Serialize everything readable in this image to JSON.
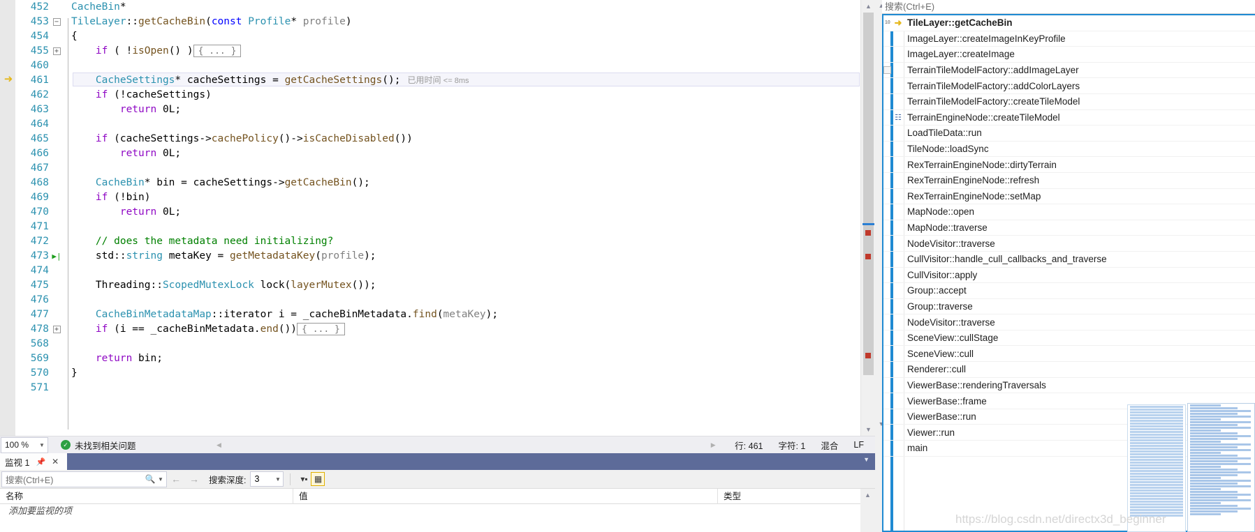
{
  "editor": {
    "current_line_arrow_icon": "execution-arrow",
    "lines": [
      {
        "num": "452",
        "glyph": "",
        "indent": 0,
        "tokens": [
          {
            "t": "CacheBin",
            "c": "t-type"
          },
          {
            "t": "*",
            "c": "t-plain"
          }
        ]
      },
      {
        "num": "453",
        "glyph": "minus",
        "indent": 0,
        "tokens": [
          {
            "t": "TileLayer",
            "c": "t-type"
          },
          {
            "t": "::",
            "c": "t-plain"
          },
          {
            "t": "getCacheBin",
            "c": "t-fn"
          },
          {
            "t": "(",
            "c": "t-plain"
          },
          {
            "t": "const",
            "c": "t-kw"
          },
          {
            "t": " ",
            "c": "t-plain"
          },
          {
            "t": "Profile",
            "c": "t-type"
          },
          {
            "t": "* ",
            "c": "t-plain"
          },
          {
            "t": "profile",
            "c": "t-param"
          },
          {
            "t": ")",
            "c": "t-plain"
          }
        ]
      },
      {
        "num": "454",
        "glyph": "",
        "indent": 0,
        "tokens": [
          {
            "t": "{",
            "c": "t-plain"
          }
        ]
      },
      {
        "num": "455",
        "glyph": "plus",
        "indent": 1,
        "tokens": [
          {
            "t": "if",
            "c": "t-ctrl"
          },
          {
            "t": " ( !",
            "c": "t-plain"
          },
          {
            "t": "isOpen",
            "c": "t-fn"
          },
          {
            "t": "() )",
            "c": "t-plain"
          }
        ],
        "collapsed": "{ ... }"
      },
      {
        "num": "460",
        "glyph": "",
        "indent": 0,
        "tokens": []
      },
      {
        "num": "461",
        "glyph": "",
        "indent": 1,
        "current": true,
        "tokens": [
          {
            "t": "CacheSettings",
            "c": "t-type"
          },
          {
            "t": "* cacheSettings = ",
            "c": "t-plain"
          },
          {
            "t": "getCacheSettings",
            "c": "t-fn"
          },
          {
            "t": "();",
            "c": "t-plain"
          }
        ],
        "exec_time": "已用时间",
        "exec_time_ms": "<= 8ms"
      },
      {
        "num": "462",
        "glyph": "",
        "indent": 1,
        "tokens": [
          {
            "t": "if",
            "c": "t-ctrl"
          },
          {
            "t": " (!cacheSettings)",
            "c": "t-plain"
          }
        ]
      },
      {
        "num": "463",
        "glyph": "",
        "indent": 2,
        "tokens": [
          {
            "t": "return",
            "c": "t-ctrl"
          },
          {
            "t": " 0L;",
            "c": "t-plain"
          }
        ]
      },
      {
        "num": "464",
        "glyph": "",
        "indent": 0,
        "tokens": []
      },
      {
        "num": "465",
        "glyph": "",
        "indent": 1,
        "tokens": [
          {
            "t": "if",
            "c": "t-ctrl"
          },
          {
            "t": " (cacheSettings->",
            "c": "t-plain"
          },
          {
            "t": "cachePolicy",
            "c": "t-fn"
          },
          {
            "t": "()->",
            "c": "t-plain"
          },
          {
            "t": "isCacheDisabled",
            "c": "t-fn"
          },
          {
            "t": "())",
            "c": "t-plain"
          }
        ]
      },
      {
        "num": "466",
        "glyph": "",
        "indent": 2,
        "tokens": [
          {
            "t": "return",
            "c": "t-ctrl"
          },
          {
            "t": " 0L;",
            "c": "t-plain"
          }
        ]
      },
      {
        "num": "467",
        "glyph": "",
        "indent": 0,
        "tokens": []
      },
      {
        "num": "468",
        "glyph": "",
        "indent": 1,
        "tokens": [
          {
            "t": "CacheBin",
            "c": "t-type"
          },
          {
            "t": "* bin = cacheSettings->",
            "c": "t-plain"
          },
          {
            "t": "getCacheBin",
            "c": "t-fn"
          },
          {
            "t": "();",
            "c": "t-plain"
          }
        ]
      },
      {
        "num": "469",
        "glyph": "",
        "indent": 1,
        "tokens": [
          {
            "t": "if",
            "c": "t-ctrl"
          },
          {
            "t": " (!bin)",
            "c": "t-plain"
          }
        ]
      },
      {
        "num": "470",
        "glyph": "",
        "indent": 2,
        "tokens": [
          {
            "t": "return",
            "c": "t-ctrl"
          },
          {
            "t": " 0L;",
            "c": "t-plain"
          }
        ]
      },
      {
        "num": "471",
        "glyph": "",
        "indent": 0,
        "tokens": []
      },
      {
        "num": "472",
        "glyph": "",
        "indent": 1,
        "tokens": [
          {
            "t": "// does the metadata need initializing?",
            "c": "t-comment"
          }
        ]
      },
      {
        "num": "473",
        "glyph": "stmt",
        "indent": 1,
        "tokens": [
          {
            "t": "std::",
            "c": "t-plain"
          },
          {
            "t": "string",
            "c": "t-type"
          },
          {
            "t": " metaKey = ",
            "c": "t-plain"
          },
          {
            "t": "getMetadataKey",
            "c": "t-fn"
          },
          {
            "t": "(",
            "c": "t-plain"
          },
          {
            "t": "profile",
            "c": "t-param"
          },
          {
            "t": ");",
            "c": "t-plain"
          }
        ]
      },
      {
        "num": "474",
        "glyph": "",
        "indent": 0,
        "tokens": []
      },
      {
        "num": "475",
        "glyph": "",
        "indent": 1,
        "tokens": [
          {
            "t": "Threading::",
            "c": "t-plain"
          },
          {
            "t": "ScopedMutexLock",
            "c": "t-type"
          },
          {
            "t": " lock(",
            "c": "t-plain"
          },
          {
            "t": "layerMutex",
            "c": "t-fn"
          },
          {
            "t": "());",
            "c": "t-plain"
          }
        ]
      },
      {
        "num": "476",
        "glyph": "",
        "indent": 0,
        "tokens": []
      },
      {
        "num": "477",
        "glyph": "",
        "indent": 1,
        "tokens": [
          {
            "t": "CacheBinMetadataMap",
            "c": "t-type"
          },
          {
            "t": "::iterator i = _cacheBinMetadata.",
            "c": "t-plain"
          },
          {
            "t": "find",
            "c": "t-fn"
          },
          {
            "t": "(",
            "c": "t-plain"
          },
          {
            "t": "metaKey",
            "c": "t-param"
          },
          {
            "t": ");",
            "c": "t-plain"
          }
        ]
      },
      {
        "num": "478",
        "glyph": "plus",
        "indent": 1,
        "tokens": [
          {
            "t": "if",
            "c": "t-ctrl"
          },
          {
            "t": " (i == _cacheBinMetadata.",
            "c": "t-plain"
          },
          {
            "t": "end",
            "c": "t-fn"
          },
          {
            "t": "())",
            "c": "t-plain"
          }
        ],
        "collapsed": "{ ... }"
      },
      {
        "num": "568",
        "glyph": "",
        "indent": 0,
        "tokens": []
      },
      {
        "num": "569",
        "glyph": "",
        "indent": 1,
        "tokens": [
          {
            "t": "return",
            "c": "t-ctrl"
          },
          {
            "t": " bin;",
            "c": "t-plain"
          }
        ]
      },
      {
        "num": "570",
        "glyph": "",
        "indent": 0,
        "tokens": [
          {
            "t": "}",
            "c": "t-plain"
          }
        ]
      },
      {
        "num": "571",
        "glyph": "",
        "indent": 0,
        "tokens": []
      }
    ]
  },
  "editor_status": {
    "zoom_level": "100 %",
    "zoom_dropdown_icon": "chevron-down-icon",
    "issue_status_icon": "check-circle-icon",
    "issue_status": "未找到相关问题",
    "prev_issue_icon": "triangle-left-icon",
    "next_issue_icon": "triangle-right-icon",
    "line_label": "行: 461",
    "char_label": "字符: 1",
    "mode_label": "混合",
    "eol_label": "LF"
  },
  "watch_panel": {
    "tab_label": "监视 1",
    "pin_icon": "pin-icon",
    "close_icon": "close-icon",
    "tab_overflow_icon": "chevron-down-icon",
    "search_placeholder": "搜索(Ctrl+E)",
    "search_icon": "magnifier-icon",
    "search_dropdown_icon": "chevron-down-icon",
    "back_icon": "arrow-left-icon",
    "forward_icon": "arrow-right-icon",
    "depth_label": "搜索深度:",
    "depth_value": "3",
    "depth_dropdown_icon": "chevron-down-icon",
    "filter_icon": "filter-pin-icon",
    "hex_icon": "hex-display-icon",
    "columns": [
      "名称",
      "值",
      "类型"
    ],
    "empty_row_text": "添加要监视的项",
    "scroll_up_icon": "triangle-up-icon"
  },
  "callstack": {
    "search_placeholder": "搜索(Ctrl+E)",
    "scroll_up_icon": "triangle-up-icon",
    "scroll_down_icon": "triangle-down-icon",
    "frames": [
      {
        "label": "TileLayer::getCacheBin",
        "icon": "execution-arrow",
        "active": true,
        "tiny": "10"
      },
      {
        "label": "ImageLayer::createImageInKeyProfile",
        "icon": "dash"
      },
      {
        "label": "ImageLayer::createImage",
        "icon": "dash"
      },
      {
        "label": "TerrainTileModelFactory::addImageLayer",
        "icon": "dash",
        "expander": true
      },
      {
        "label": "TerrainTileModelFactory::addColorLayers",
        "icon": "dash"
      },
      {
        "label": "TerrainTileModelFactory::createTileModel",
        "icon": "dash"
      },
      {
        "label": "TerrainEngineNode::createTileModel",
        "icon": "frame"
      },
      {
        "label": "LoadTileData::run",
        "icon": "dash"
      },
      {
        "label": "TileNode::loadSync",
        "icon": "dash"
      },
      {
        "label": "RexTerrainEngineNode::dirtyTerrain",
        "icon": "dash"
      },
      {
        "label": "RexTerrainEngineNode::refresh",
        "icon": "dash"
      },
      {
        "label": "RexTerrainEngineNode::setMap",
        "icon": "dash"
      },
      {
        "label": "MapNode::open",
        "icon": "dash"
      },
      {
        "label": "MapNode::traverse",
        "icon": "dash"
      },
      {
        "label": "NodeVisitor::traverse",
        "icon": "dash"
      },
      {
        "label": "CullVisitor::handle_cull_callbacks_and_traverse",
        "icon": "dash"
      },
      {
        "label": "CullVisitor::apply",
        "icon": "dash"
      },
      {
        "label": "Group::accept",
        "icon": "dash"
      },
      {
        "label": "Group::traverse",
        "icon": "dash"
      },
      {
        "label": "NodeVisitor::traverse",
        "icon": "dash"
      },
      {
        "label": "SceneView::cullStage",
        "icon": "dash"
      },
      {
        "label": "SceneView::cull",
        "icon": "dash"
      },
      {
        "label": "Renderer::cull",
        "icon": "dash"
      },
      {
        "label": "ViewerBase::renderingTraversals",
        "icon": "dash"
      },
      {
        "label": "ViewerBase::frame",
        "icon": "dash"
      },
      {
        "label": "ViewerBase::run",
        "icon": "dash"
      },
      {
        "label": "Viewer::run",
        "icon": "dash"
      },
      {
        "label": "main",
        "icon": "dash"
      }
    ]
  },
  "watermark": "https://blog.csdn.net/directx3d_beginner"
}
